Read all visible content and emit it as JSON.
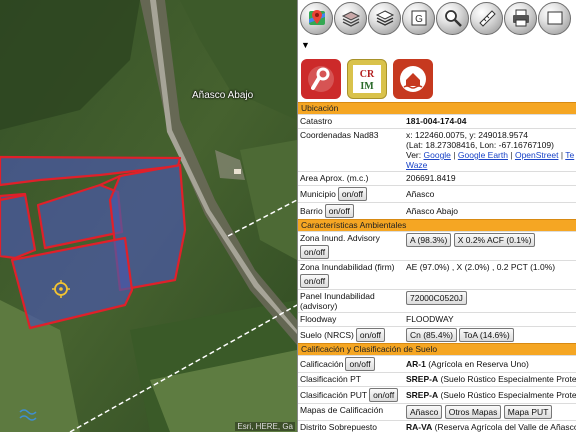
{
  "map": {
    "place_label": "Añasco Abajo",
    "attribution": "Esri, HERE, Ga"
  },
  "toolbar": {
    "buttons": [
      {
        "name": "google-maps",
        "icon": "map-pin-icon"
      },
      {
        "name": "basemap",
        "icon": "layers-icon"
      },
      {
        "name": "layers",
        "icon": "layers-icon"
      },
      {
        "name": "google",
        "icon": "globe-icon"
      },
      {
        "name": "search",
        "icon": "search-icon"
      },
      {
        "name": "measure",
        "icon": "ruler-icon"
      },
      {
        "name": "print",
        "icon": "printer-icon"
      },
      {
        "name": "more",
        "icon": "more-icon"
      }
    ]
  },
  "info": {
    "sec_location": "Ubicación",
    "catastro_label": "Catastro",
    "catastro_value": "181-004-174-04",
    "coords_label": "Coordenadas Nad83",
    "coords_line1": "x: 122460.0075, y: 249018.9574",
    "coords_line2": "(Lat: 18.27308416, Lon: -67.16767109)",
    "coords_ver": "Ver:",
    "links": [
      "Google",
      "Google Earth",
      "OpenStreet",
      "Te"
    ],
    "link_waze": "Waze",
    "area_label": "Area Aprox. (m.c.)",
    "area_value": "206691.8419",
    "municipio_label": "Municipio",
    "municipio_value": "Añasco",
    "barrio_label": "Barrio",
    "barrio_value": "Añasco Abajo",
    "onoff": "on/off",
    "sec_env": "Características Ambientales",
    "flood_adv_label": "Zona Inund. Advisory",
    "flood_adv_btn1": "A (98.3%)",
    "flood_adv_btn2": "X 0.2% ACF (0.1%)",
    "flood_firm_label": "Zona Inundabilidad (firm)",
    "flood_firm_value": "AE (97.0%) , X (2.0%) , 0.2 PCT (1.0%)",
    "panel_label": "Panel Inundabilidad (advisory)",
    "panel_value": "72000C0520J",
    "floodway_label": "Floodway",
    "floodway_value": "FLOODWAY",
    "suelo_label": "Suelo (NRCS)",
    "suelo_btn1": "Cn (85.4%)",
    "suelo_btn2": "ToA (14.6%)",
    "sec_calif": "Calificación y Clasificación de Suelo",
    "calif_label": "Calificación",
    "calif_code": "AR-1",
    "calif_desc": "(Agrícola en Reserva Uno)",
    "clas_pt_label": "Clasificación PT",
    "clas_pt_code": "SREP-A",
    "clas_pt_desc": "(Suelo Rústico Especialmente Prote",
    "clas_put_label": "Clasificación PUT",
    "clas_put_code": "SREP-A",
    "clas_put_desc": "(Suelo Rústico Especialmente Prote",
    "mapas_label": "Mapas de Calificación",
    "mapas_btn1": "Añasco",
    "mapas_btn2": "Otros Mapas",
    "mapas_btn3": "Mapa PUT",
    "distrito_label": "Distrito Sobrepuesto",
    "distrito_code": "RA-VA",
    "distrito_desc": "(Reserva Agrícola del Valle de Añasco)"
  }
}
